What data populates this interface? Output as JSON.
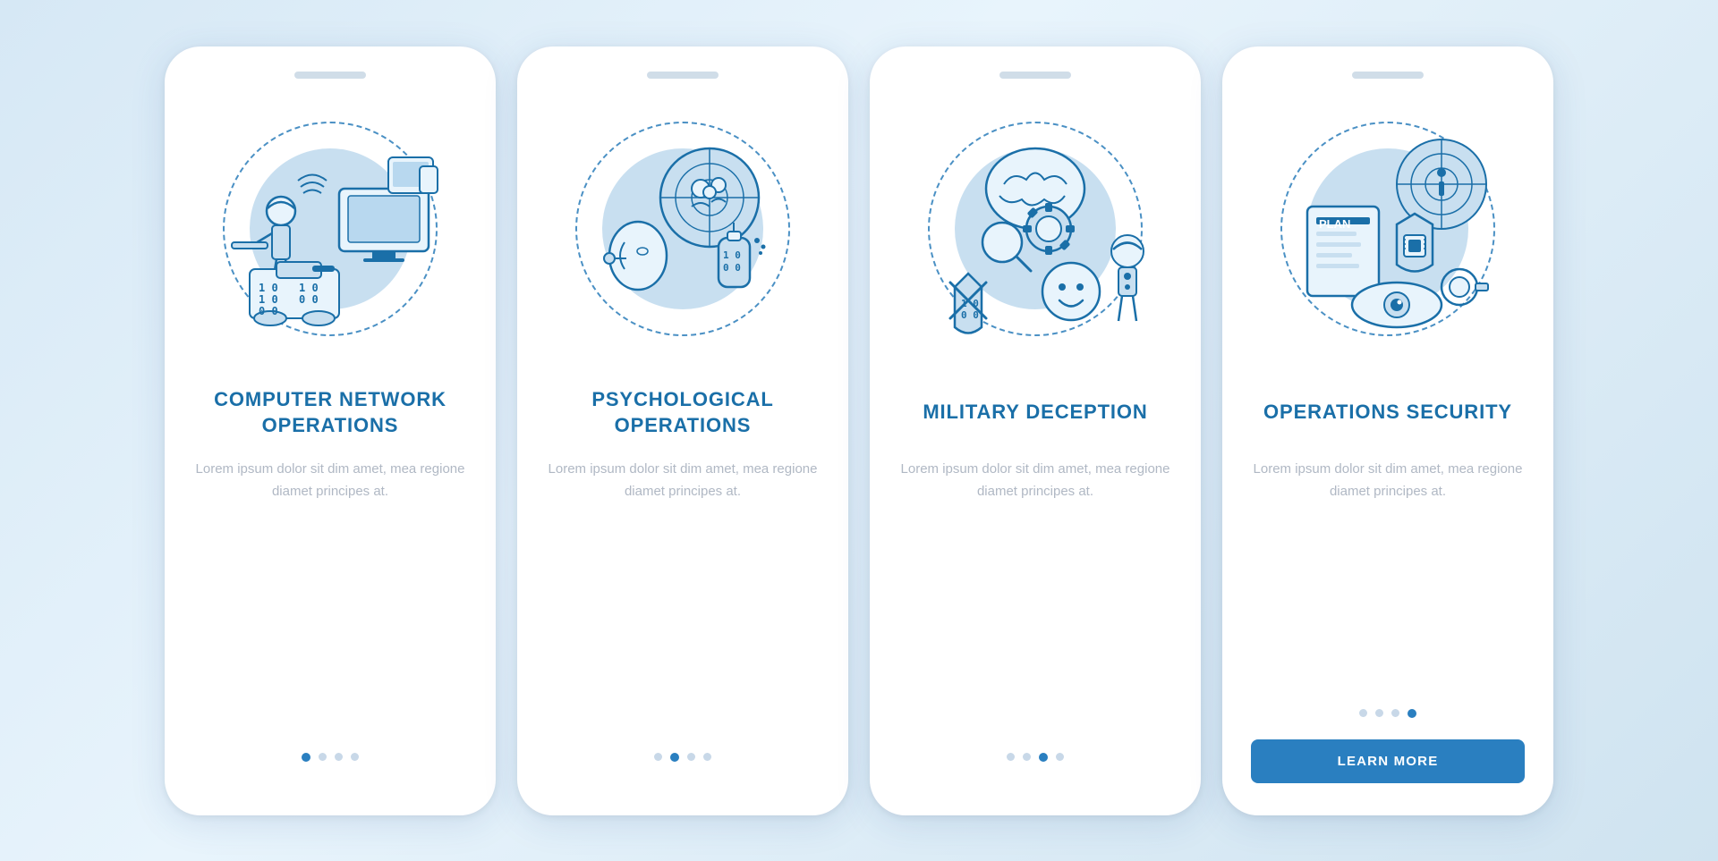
{
  "background_color": "#d2e8f5",
  "cards": [
    {
      "id": "computer-network",
      "title": "COMPUTER NETWORK OPERATIONS",
      "description": "Lorem ipsum dolor sit dim amet, mea regione diamet principes at.",
      "dots": [
        {
          "active": true
        },
        {
          "active": false
        },
        {
          "active": false
        },
        {
          "active": false
        }
      ],
      "show_button": false,
      "button_label": ""
    },
    {
      "id": "psychological",
      "title": "PSYCHOLOGICAL OPERATIONS",
      "description": "Lorem ipsum dolor sit dim amet, mea regione diamet principes at.",
      "dots": [
        {
          "active": false
        },
        {
          "active": true
        },
        {
          "active": false
        },
        {
          "active": false
        }
      ],
      "show_button": false,
      "button_label": ""
    },
    {
      "id": "military-deception",
      "title": "MILITARY DECEPTION",
      "description": "Lorem ipsum dolor sit dim amet, mea regione diamet principes at.",
      "dots": [
        {
          "active": false
        },
        {
          "active": false
        },
        {
          "active": true
        },
        {
          "active": false
        }
      ],
      "show_button": false,
      "button_label": ""
    },
    {
      "id": "operations-security",
      "title": "OPERATIONS SECURITY",
      "description": "Lorem ipsum dolor sit dim amet, mea regione diamet principes at.",
      "dots": [
        {
          "active": false
        },
        {
          "active": false
        },
        {
          "active": false
        },
        {
          "active": true
        }
      ],
      "show_button": true,
      "button_label": "LEARN MORE"
    }
  ]
}
